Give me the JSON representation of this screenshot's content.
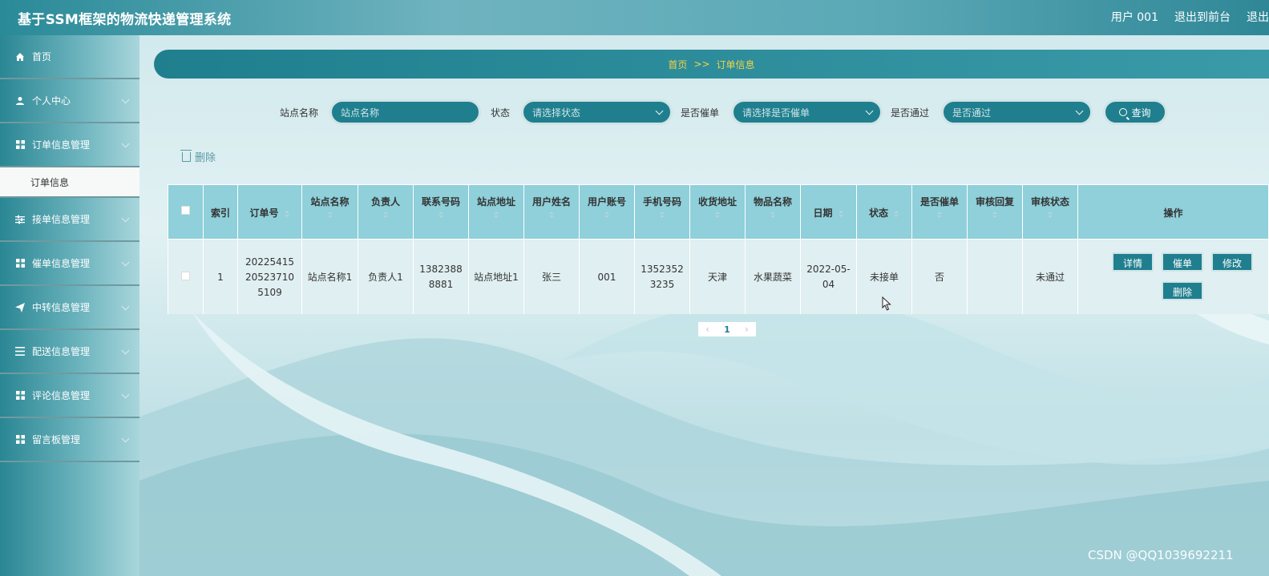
{
  "header": {
    "app_title": "基于SSM框架的物流快递管理系统",
    "user": "用户 001",
    "back_to_front": "退出到前台",
    "logout": "退出"
  },
  "sidebar": {
    "items": [
      {
        "label": "首页",
        "icon": "home-icon",
        "has_arrow": false
      },
      {
        "label": "个人中心",
        "icon": "user-icon",
        "has_arrow": true
      },
      {
        "label": "订单信息管理",
        "icon": "grid-icon",
        "has_arrow": true
      },
      {
        "label": "接单信息管理",
        "icon": "sliders-icon",
        "has_arrow": true
      },
      {
        "label": "催单信息管理",
        "icon": "grid-icon",
        "has_arrow": true
      },
      {
        "label": "中转信息管理",
        "icon": "send-icon",
        "has_arrow": true
      },
      {
        "label": "配送信息管理",
        "icon": "list-icon",
        "has_arrow": true
      },
      {
        "label": "评论信息管理",
        "icon": "grid-icon",
        "has_arrow": true
      },
      {
        "label": "留言板管理",
        "icon": "grid-icon",
        "has_arrow": true
      }
    ],
    "active_sub": "订单信息"
  },
  "breadcrumb": {
    "home": "首页",
    "sep": ">>",
    "current": "订单信息"
  },
  "search": {
    "station_label": "站点名称",
    "station_placeholder": "站点名称",
    "status_label": "状态",
    "status_placeholder": "请选择状态",
    "urge_label": "是否催单",
    "urge_placeholder": "请选择是否催单",
    "pass_label": "是否通过",
    "pass_placeholder": "是否通过",
    "query_button": "查询"
  },
  "toolbar": {
    "delete_label": "删除"
  },
  "table": {
    "headers": [
      "索引",
      "订单号",
      "站点名称",
      "负责人",
      "联系号码",
      "站点地址",
      "用户姓名",
      "用户账号",
      "手机号码",
      "收货地址",
      "物品名称",
      "日期",
      "状态",
      "是否催单",
      "审核回复",
      "审核状态",
      "操作"
    ],
    "rows": [
      {
        "index": "1",
        "order_no": "20225415205237105109",
        "station_name": "站点名称1",
        "manager": "负责人1",
        "contact": "13823888881",
        "station_addr": "站点地址1",
        "user_name": "张三",
        "account": "001",
        "phone": "13523523235",
        "recv_addr": "天津",
        "item": "水果蔬菜",
        "date": "2022-05-04",
        "status": "未接单",
        "urged": "否",
        "reply": "",
        "audit": "未通过"
      }
    ],
    "ops": {
      "detail": "详情",
      "urge": "催单",
      "edit": "修改",
      "delete": "删除"
    }
  },
  "pager": {
    "current": "1"
  },
  "watermark": "CSDN @QQ1039692211",
  "colors": {
    "primary": "#1f7f8e",
    "header_bg": "#8fd0da",
    "crumb_text": "#f3d34a"
  }
}
